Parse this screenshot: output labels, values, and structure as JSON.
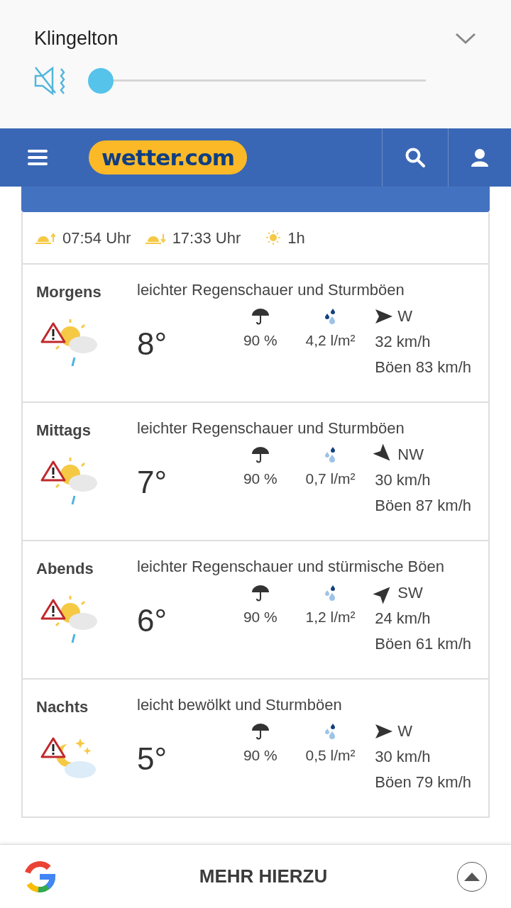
{
  "volume_panel": {
    "title": "Klingelton",
    "muted": true,
    "level": 0
  },
  "header": {
    "logo": "wetter.com"
  },
  "sun": {
    "sunrise": "07:54 Uhr",
    "sunset": "17:33 Uhr",
    "sunshine": "1h"
  },
  "periods": [
    {
      "name": "Morgens",
      "description": "leichter Regenschauer und Sturmböen",
      "kind": "day",
      "temperature": "8°",
      "rain_chance": "90 %",
      "rain_amount": "4,2 l/m²",
      "raindrops": {
        "kind": "heavy"
      },
      "wind_arrow": {
        "kind": "east"
      },
      "direction": "W",
      "wind": "32 km/h",
      "gusts": "Böen 83 km/h"
    },
    {
      "name": "Mittags",
      "description": "leichter Regenschauer und Sturmböen",
      "kind": "day",
      "temperature": "7°",
      "rain_chance": "90 %",
      "rain_amount": "0,7 l/m²",
      "raindrops": {
        "kind": "light"
      },
      "wind_arrow": {
        "kind": "southeast"
      },
      "direction": "NW",
      "wind": "30 km/h",
      "gusts": "Böen 87 km/h"
    },
    {
      "name": "Abends",
      "description": "leichter Regenschauer und stürmische Böen",
      "kind": "day",
      "temperature": "6°",
      "rain_chance": "90 %",
      "rain_amount": "1,2 l/m²",
      "raindrops": {
        "kind": "light"
      },
      "wind_arrow": {
        "kind": "northeast"
      },
      "direction": "SW",
      "wind": "24 km/h",
      "gusts": "Böen 61 km/h"
    },
    {
      "name": "Nachts",
      "description": "leicht bewölkt und Sturmböen",
      "kind": "night",
      "temperature": "5°",
      "rain_chance": "90 %",
      "rain_amount": "0,5 l/m²",
      "raindrops": {
        "kind": "light"
      },
      "wind_arrow": {
        "kind": "east"
      },
      "direction": "W",
      "wind": "30 km/h",
      "gusts": "Böen 79 km/h"
    }
  ],
  "bottom_bar": {
    "label": "MEHR HIERZU"
  }
}
